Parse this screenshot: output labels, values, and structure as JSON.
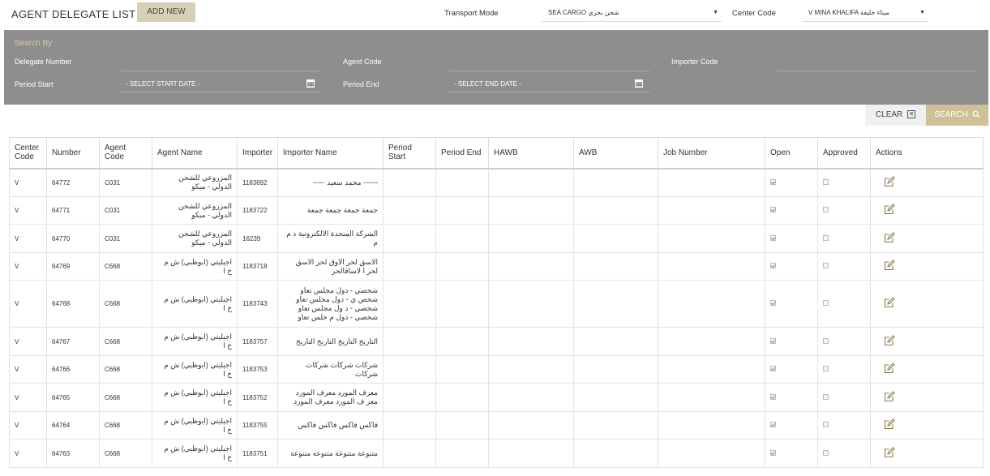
{
  "header": {
    "title": "AGENT DELEGATE LIST",
    "add_new_label": "ADD NEW",
    "transport_mode_label": "Transport Mode",
    "transport_mode_value": "SEA CARGO شحن بحري",
    "center_code_label": "Center Code",
    "center_code_value": "V MINA KHALIFA ميناء خليفة"
  },
  "search": {
    "title": "Search By",
    "delegate_number_label": "Delegate Number",
    "delegate_number_value": "",
    "agent_code_label": "Agent Code",
    "agent_code_value": "",
    "importer_code_label": "Importer Code",
    "importer_code_value": "",
    "period_start_label": "Period Start",
    "period_start_placeholder": "- SELECT START DATE -",
    "period_end_label": "Period End",
    "period_end_placeholder": "- SELECT END DATE -",
    "clear_label": "CLEAR",
    "search_label": "SEARCH"
  },
  "table": {
    "columns": [
      "Center Code",
      "Number",
      "Agent Code",
      "Agent Name",
      "Importer",
      "Importer Name",
      "Period Start",
      "Period End",
      "HAWB",
      "AWB",
      "Job Number",
      "Open",
      "Approved",
      "Actions"
    ],
    "rows": [
      {
        "center": "V",
        "number": "64772",
        "agent_code": "C031",
        "agent_name": "المزروعي للشحن الدولي - ميكو",
        "importer": "1183692",
        "importer_name": "------ محمد سعيد -----",
        "open": true,
        "approved": false
      },
      {
        "center": "V",
        "number": "64771",
        "agent_code": "C031",
        "agent_name": "المزروعي للشحن الدولي - ميكو",
        "importer": "1183722",
        "importer_name": "جمعة جمعة جمعة جمعة",
        "open": true,
        "approved": false
      },
      {
        "center": "V",
        "number": "64770",
        "agent_code": "C031",
        "agent_name": "المزروعي للشحن الدولي - ميكو",
        "importer": "16239",
        "importer_name": "الشركة المتحدة الالكترونية ذ م م",
        "open": true,
        "approved": false
      },
      {
        "center": "V",
        "number": "64769",
        "agent_code": "C668",
        "agent_name": "اجيليتي (ابوظبي) ش م خ ا",
        "importer": "1183718",
        "importer_name": "الاسق لحر الاوق لحر الاسق لحر ا لاساقالحر",
        "open": true,
        "approved": false
      },
      {
        "center": "V",
        "number": "64768",
        "agent_code": "C668",
        "agent_name": "اجيليتي (ابوظبي) ش م خ ا",
        "importer": "1183743",
        "importer_name": "شخصي - دول مجلس تعاو شخص ي - دول مجلس تعاو شخصي - د ول مجلس تعاو شخصي - دول م جلس تعاو",
        "open": true,
        "approved": false
      },
      {
        "center": "V",
        "number": "64767",
        "agent_code": "C668",
        "agent_name": "اجيليتي (ابوظبي) ش م خ ا",
        "importer": "1183757",
        "importer_name": "التاريخ التاريخ التاريخ التاريخ",
        "open": true,
        "approved": false
      },
      {
        "center": "V",
        "number": "64766",
        "agent_code": "C668",
        "agent_name": "اجيليتي (ابوظبي) ش م خ ا",
        "importer": "1183753",
        "importer_name": "شركات شركات شركات شركات",
        "open": true,
        "approved": false
      },
      {
        "center": "V",
        "number": "64765",
        "agent_code": "C668",
        "agent_name": "اجيليتي (ابوظبي) ش م خ ا",
        "importer": "1183752",
        "importer_name": "معرف المورد معرف المورد معر ف المورد معرف المورد",
        "open": true,
        "approved": false
      },
      {
        "center": "V",
        "number": "64764",
        "agent_code": "C668",
        "agent_name": "اجيليتي (ابوظبي) ش م خ ا",
        "importer": "1183755",
        "importer_name": "فاكس فاكس فاكس فاكس",
        "open": true,
        "approved": false
      },
      {
        "center": "V",
        "number": "64763",
        "agent_code": "C668",
        "agent_name": "اجيليتي (ابوظبي) ش م خ ا",
        "importer": "1183751",
        "importer_name": "متنوعة متنوعة متنوعة متنوعة",
        "open": true,
        "approved": false
      }
    ]
  },
  "icons": {
    "calendar": "calendar-icon",
    "clear": "close-box-icon",
    "search": "magnifier-icon",
    "edit": "edit-icon",
    "dropdown": "caret-down-icon"
  },
  "colors": {
    "search_panel_bg": "#8e8e8e",
    "accent_gold": "#cfc099",
    "add_button_bg": "#d8cfb8"
  }
}
